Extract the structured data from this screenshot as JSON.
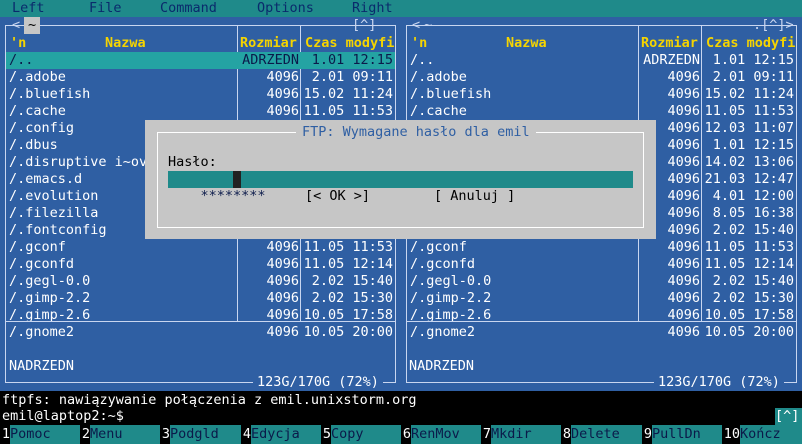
{
  "menu": [
    "Left",
    "File",
    "Command",
    "Options",
    "Right"
  ],
  "left_panel": {
    "tab": "~",
    "top_right": "[^]",
    "headers": {
      "name_sort": "'n",
      "name": "Nazwa",
      "size": "Rozmiar",
      "mtime": "Czas modyfi"
    },
    "rows": [
      {
        "name": "/..",
        "size": "ADRZEDN",
        "time": "1.01 12:15"
      },
      {
        "name": "/.adobe",
        "size": "4096",
        "time": "2.01 09:11"
      },
      {
        "name": "/.bluefish",
        "size": "4096",
        "time": "15.02 11:24"
      },
      {
        "name": "/.cache",
        "size": "4096",
        "time": "11.05 11:53"
      },
      {
        "name": "/.config",
        "size": "",
        "time": ""
      },
      {
        "name": "/.dbus",
        "size": "",
        "time": ""
      },
      {
        "name": "/.disruptive i~ov",
        "size": "",
        "time": ""
      },
      {
        "name": "/.emacs.d",
        "size": "",
        "time": ""
      },
      {
        "name": "/.evolution",
        "size": "",
        "time": ""
      },
      {
        "name": "/.filezilla",
        "size": "",
        "time": ""
      },
      {
        "name": "/.fontconfig",
        "size": "",
        "time": ""
      },
      {
        "name": "/.gconf",
        "size": "4096",
        "time": "11.05 11:53"
      },
      {
        "name": "/.gconfd",
        "size": "4096",
        "time": "11.05 12:14"
      },
      {
        "name": "/.gegl-0.0",
        "size": "4096",
        "time": "2.02 15:40"
      },
      {
        "name": "/.gimp-2.2",
        "size": "4096",
        "time": "2.02 15:30"
      },
      {
        "name": "/.gimp-2.6",
        "size": "4096",
        "time": "10.05 17:58"
      },
      {
        "name": "/.gnome2",
        "size": "4096",
        "time": "10.05 20:00"
      }
    ],
    "status": "NADRZEDN",
    "disk": "123G/170G (72%)"
  },
  "right_panel": {
    "tab": "~",
    "top_right": ".[^]>",
    "headers": {
      "name_sort": "'n",
      "name": "Nazwa",
      "size": "Rozmiar",
      "mtime": "Czas modyfi"
    },
    "rows": [
      {
        "name": "/..",
        "size": "ADRZEDN",
        "time": "1.01 12:15"
      },
      {
        "name": "/.adobe",
        "size": "4096",
        "time": "2.01 09:11"
      },
      {
        "name": "/.bluefish",
        "size": "4096",
        "time": "15.02 11:24"
      },
      {
        "name": "/.cache",
        "size": "4096",
        "time": "11.05 11:53"
      },
      {
        "name": "",
        "size": "4096",
        "time": "12.03 11:07"
      },
      {
        "name": "",
        "size": "4096",
        "time": "1.01 12:15"
      },
      {
        "name": "",
        "size": "4096",
        "time": "14.02 13:06"
      },
      {
        "name": "",
        "size": "4096",
        "time": "21.03 12:47"
      },
      {
        "name": "",
        "size": "4096",
        "time": "4.01 12:00"
      },
      {
        "name": "",
        "size": "4096",
        "time": "8.05 16:38"
      },
      {
        "name": "",
        "size": "4096",
        "time": "2.02 15:40"
      },
      {
        "name": "/.gconf",
        "size": "4096",
        "time": "11.05 11:53"
      },
      {
        "name": "/.gconfd",
        "size": "4096",
        "time": "11.05 12:14"
      },
      {
        "name": "/.gegl-0.0",
        "size": "4096",
        "time": "2.02 15:40"
      },
      {
        "name": "/.gimp-2.2",
        "size": "4096",
        "time": "2.02 15:30"
      },
      {
        "name": "/.gimp-2.6",
        "size": "4096",
        "time": "10.05 17:58"
      },
      {
        "name": "/.gnome2",
        "size": "4096",
        "time": "10.05 20:00"
      }
    ],
    "status": "NADRZEDN",
    "disk": "123G/170G (72%)"
  },
  "dialog": {
    "title": "FTP: Wymagane hasło dla emil",
    "label": "Hasło:",
    "password_value": "********",
    "ok_label": "[< OK >]",
    "cancel_label": "[ Anuluj ]"
  },
  "console": {
    "status_line": "ftpfs: nawiązywanie połączenia z emil.unixstorm.org",
    "prompt": "emil@laptop2:~$",
    "hint": "[^]"
  },
  "fkeys": [
    {
      "num": "1",
      "label": "Pomoc"
    },
    {
      "num": "2",
      "label": "Menu"
    },
    {
      "num": "3",
      "label": "Podgld"
    },
    {
      "num": "4",
      "label": "Edycja"
    },
    {
      "num": "5",
      "label": "Copy"
    },
    {
      "num": "6",
      "label": "RenMov"
    },
    {
      "num": "7",
      "label": "Mkdir"
    },
    {
      "num": "8",
      "label": "Delete"
    },
    {
      "num": "9",
      "label": "PullDn"
    },
    {
      "num": "10",
      "label": "Kończ"
    }
  ]
}
